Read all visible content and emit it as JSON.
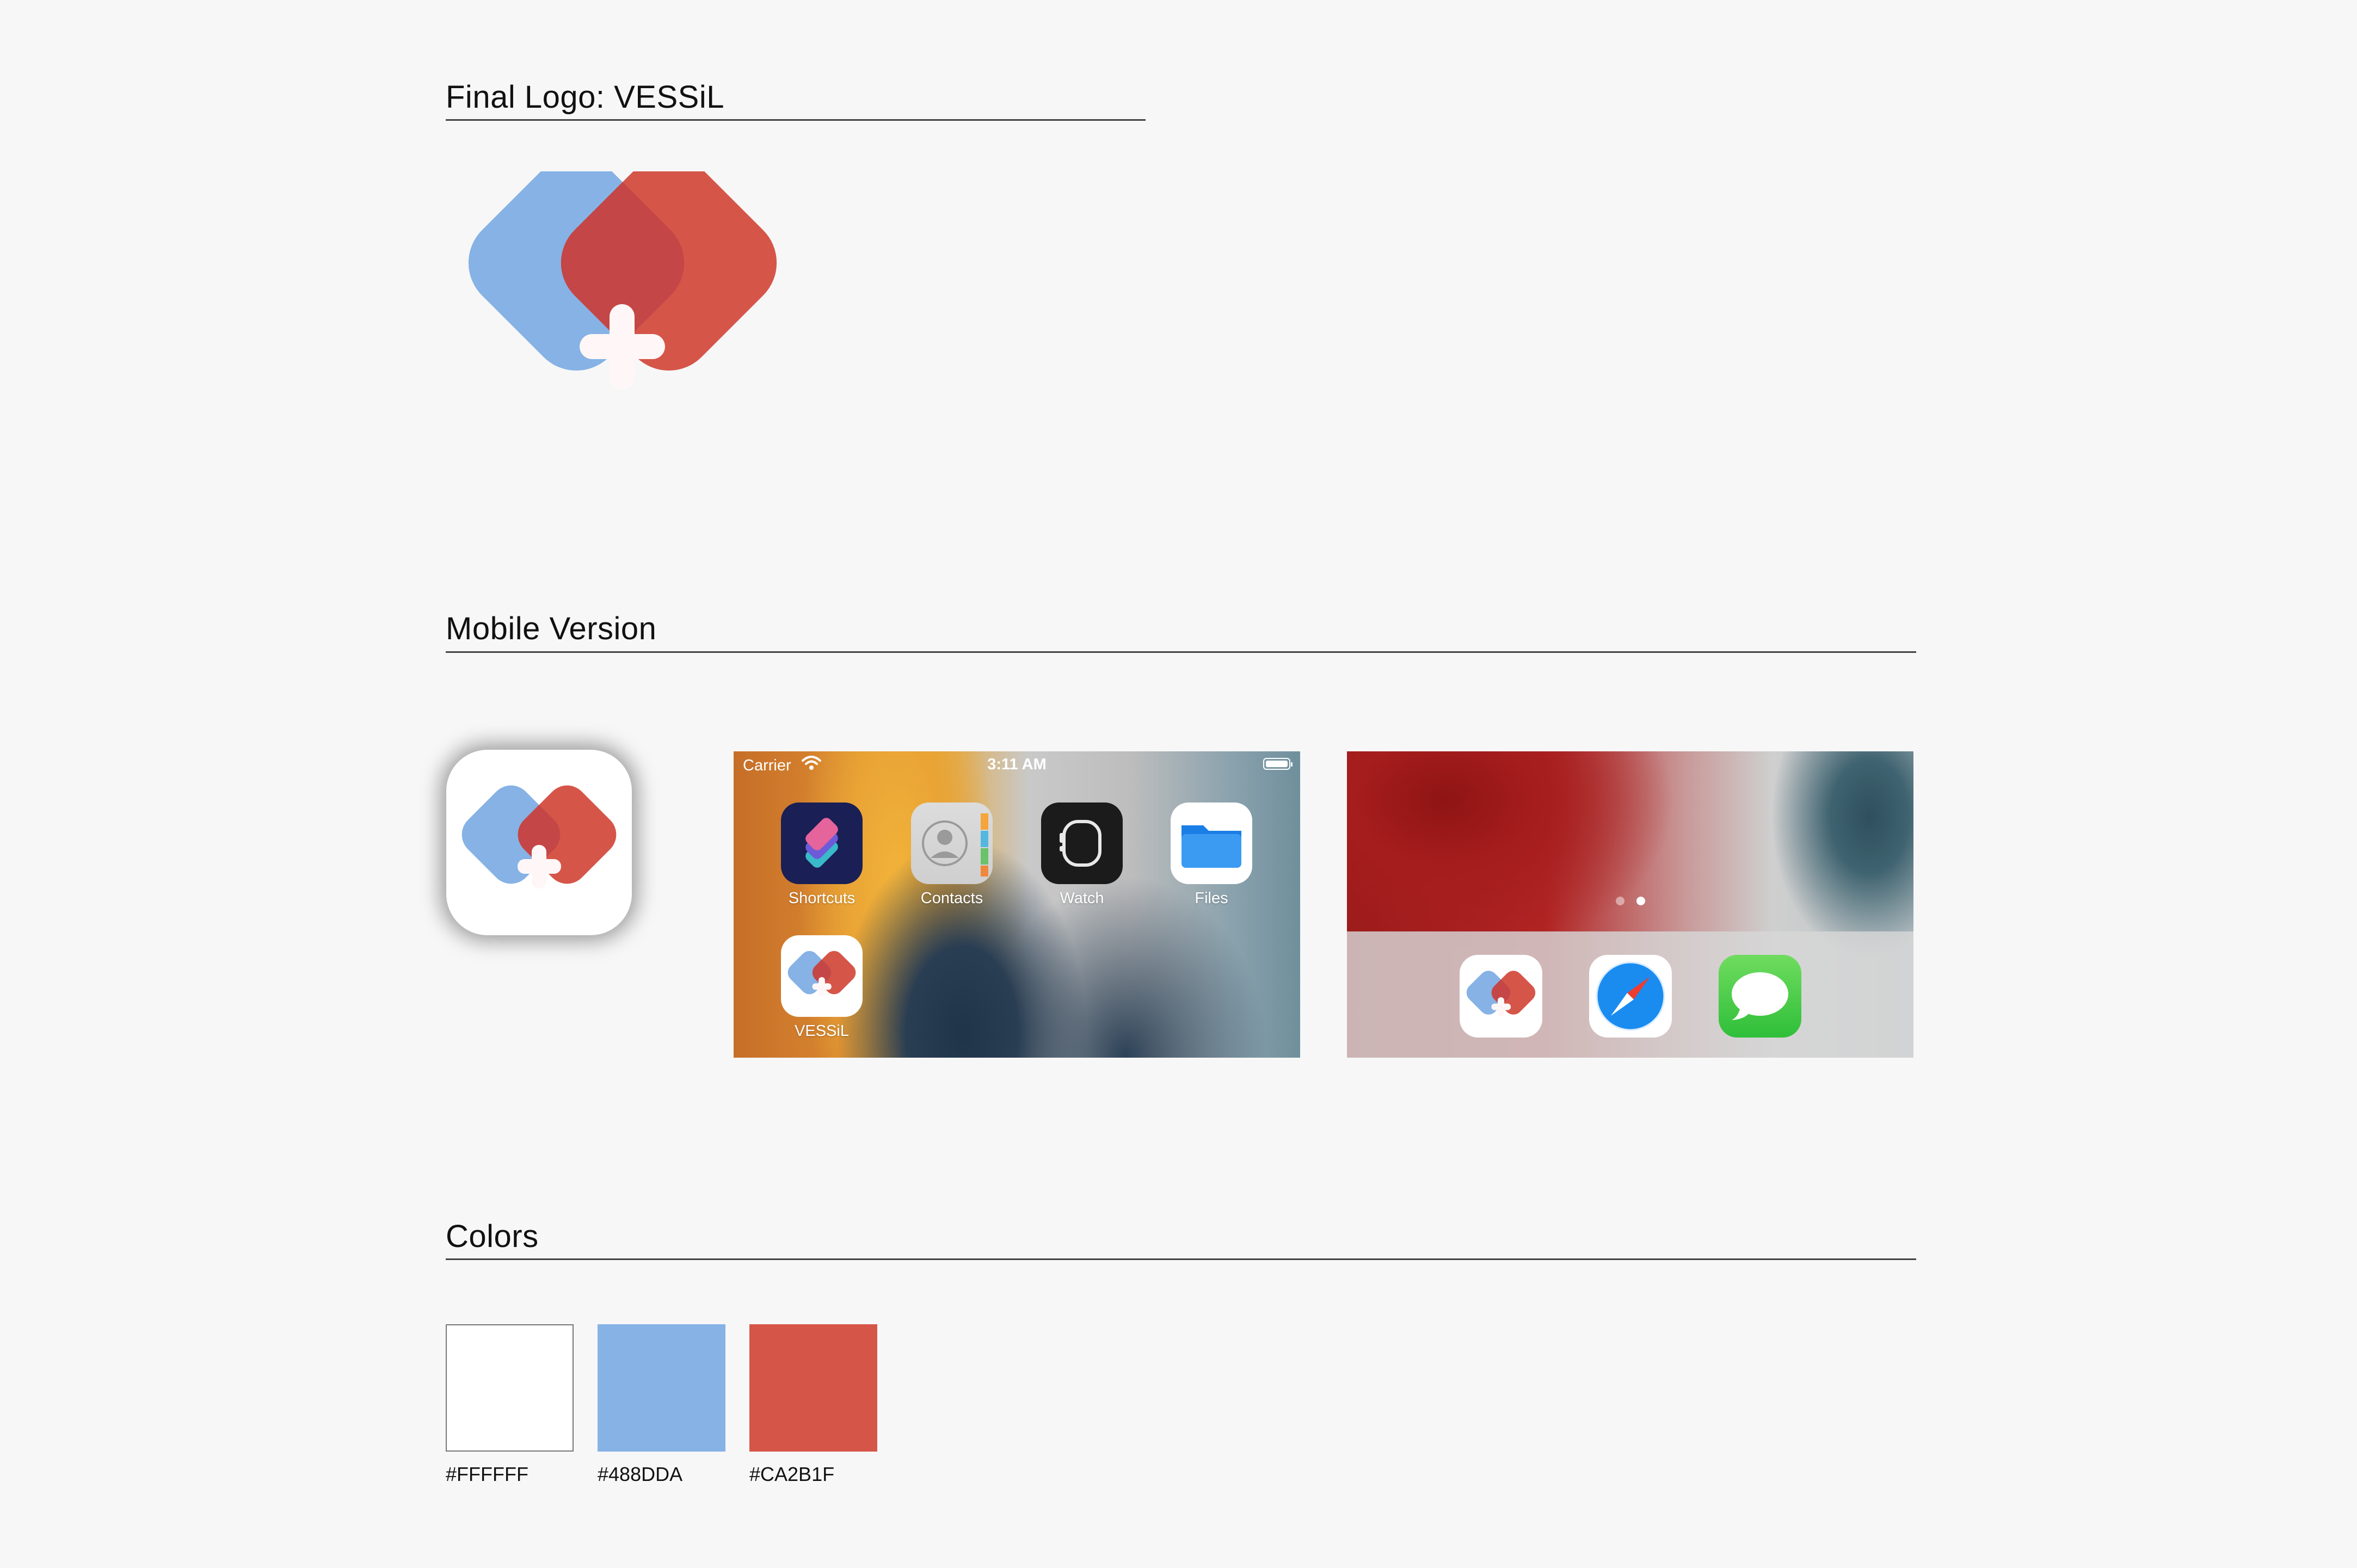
{
  "sections": {
    "logo": {
      "title": "Final Logo: VESSiL"
    },
    "mobile": {
      "title": "Mobile Version"
    },
    "colors": {
      "title": "Colors"
    }
  },
  "brand": {
    "blue_fill": "#86B2E5",
    "red_fill": "#D65549",
    "overlap_fill": "#C44646",
    "cross": "#FFF7F7"
  },
  "home_screen": {
    "status": {
      "carrier": "Carrier",
      "time": "3:11 AM"
    },
    "apps": [
      {
        "label": "Shortcuts",
        "icon": "shortcuts-icon"
      },
      {
        "label": "Contacts",
        "icon": "contacts-icon"
      },
      {
        "label": "Watch",
        "icon": "watch-icon"
      },
      {
        "label": "Files",
        "icon": "files-folder-icon"
      },
      {
        "label": "VESSiL",
        "icon": "vessil-logo-icon"
      }
    ]
  },
  "dock_screen": {
    "page_dots": {
      "count": 2,
      "active_index": 1
    },
    "dock_apps": [
      "vessil-logo-icon",
      "safari-compass-icon",
      "messages-bubble-icon"
    ]
  },
  "palette": [
    {
      "hex": "#FFFFFF",
      "label": "#FFFFFF"
    },
    {
      "hex": "#86B2E5",
      "label": "#488DDA"
    },
    {
      "hex": "#D65549",
      "label": "#CA2B1F"
    }
  ]
}
